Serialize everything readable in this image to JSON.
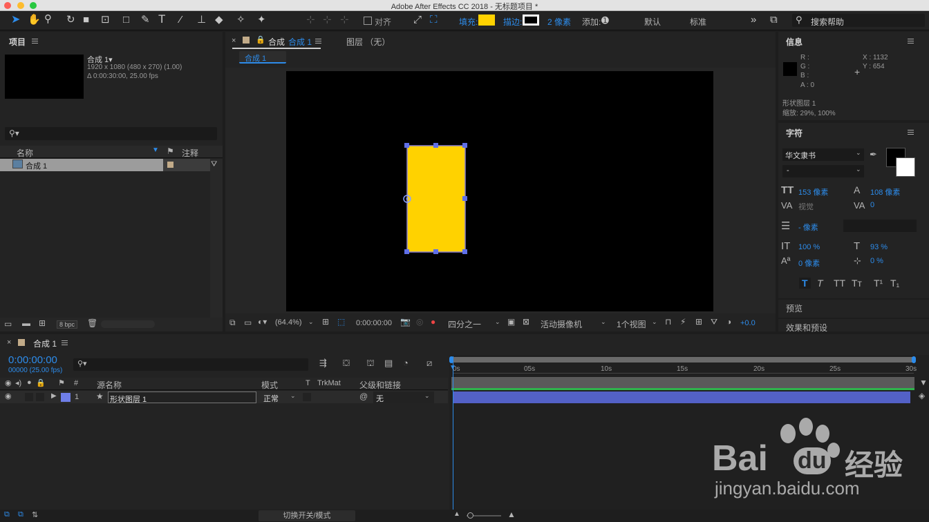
{
  "titlebar": {
    "title": "Adobe After Effects CC 2018 - 无标题项目 *"
  },
  "toolbar": {
    "snap_label": "对齐",
    "fill_label": "填充:",
    "fill_color": "#ffd200",
    "stroke_label": "描边:",
    "stroke_width": "2 像素",
    "add_label": "添加:",
    "workspace_default": "默认",
    "workspace_standard": "标准",
    "search_help": "搜索帮助"
  },
  "project": {
    "title": "项目",
    "comp_name": "合成 1▾",
    "comp_size": "1920 x 1080  (480 x 270) (1.00)",
    "comp_duration": "Δ 0:00:30:00, 25.00 fps",
    "col_name": "名称",
    "col_comment": "注释",
    "item_name": "合成 1",
    "bpc": "8 bpc"
  },
  "comp_panel": {
    "tab_prefix": "合成",
    "tab_name": "合成 1",
    "layer_tab": "图层 （无）",
    "crumb": "合成 1",
    "zoom": "(64.4%)",
    "timecode": "0:00:00:00",
    "resolution": "四分之一",
    "camera": "活动摄像机",
    "views": "1个视图",
    "exposure": "+0.0"
  },
  "info": {
    "title": "信息",
    "r": "R :",
    "g": "G :",
    "b": "B :",
    "a": "A : 0",
    "x": "X : 1132",
    "y": "Y : 654",
    "layer": "形状图层 1",
    "scale": "缩放: 29%, 100%"
  },
  "character": {
    "title": "字符",
    "font": "华文隶书",
    "style": "-",
    "size": "153 像素",
    "leading": "108 像素",
    "kerning": "视觉",
    "tracking": "0",
    "stroke": "- 像素",
    "vscale": "100 %",
    "hscale": "93 %",
    "baseline": "0 像素",
    "tsume": "0 %",
    "styles": [
      "T",
      "T",
      "TT",
      "Tт",
      "T¹",
      "T₁"
    ]
  },
  "preview_title": "预览",
  "effects_title": "效果和预设",
  "timeline": {
    "tab": "合成 1",
    "timecode": "0:00:00:00",
    "frames": "00000 (25.00 fps)",
    "cols": {
      "source": "源名称",
      "mode": "模式",
      "t": "T",
      "trkmat": "TrkMat",
      "parent": "父级和链接",
      "num": "#"
    },
    "ruler": [
      "0s",
      "05s",
      "10s",
      "15s",
      "20s",
      "25s",
      "30s"
    ],
    "layer": {
      "num": "1",
      "name": "形状图层 1",
      "mode": "正常",
      "parent": "无"
    },
    "toggle": "切换开关/模式"
  },
  "watermark": {
    "brand": "Bai",
    "brand2": "经验",
    "url": "jingyan.baidu.com"
  }
}
